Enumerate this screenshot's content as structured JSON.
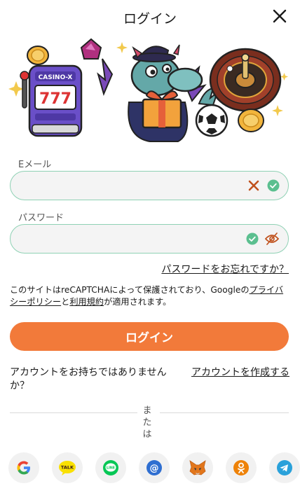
{
  "header": {
    "title": "ログイン"
  },
  "hero": {
    "slot_sign": "CASINO-X",
    "slot_digits": "777"
  },
  "email": {
    "label": "Eメール",
    "value": "",
    "placeholder": ""
  },
  "password": {
    "label": "パスワード",
    "value": "",
    "placeholder": ""
  },
  "forgot_password": "パスワードをお忘れですか？",
  "recaptcha": {
    "prefix": "このサイトはreCAPTCHAによって保護されており、Googleの",
    "privacy_link": "プライバシーポリシー",
    "connector": "と",
    "terms_link": "利用規約",
    "suffix": "が適用されます。"
  },
  "login_button": "ログイン",
  "no_account_text": "アカウントをお持ちではありませんか？",
  "create_account_link": "アカウントを作成する",
  "divider_text": "または",
  "social": [
    {
      "icon": "google-icon",
      "label": ""
    },
    {
      "icon": "kakaotalk-icon",
      "label": "TALK"
    },
    {
      "icon": "line-icon",
      "label": "LINE"
    },
    {
      "icon": "email-icon",
      "label": "@"
    },
    {
      "icon": "metamask-icon",
      "label": ""
    },
    {
      "icon": "odnoklassniki-icon",
      "label": ""
    },
    {
      "icon": "telegram-icon",
      "label": ""
    }
  ],
  "colors": {
    "accent": "#f27a3a",
    "field_border": "#8fd1b4",
    "valid_green": "#5bbf8f",
    "clear_x": "#c0521e"
  }
}
